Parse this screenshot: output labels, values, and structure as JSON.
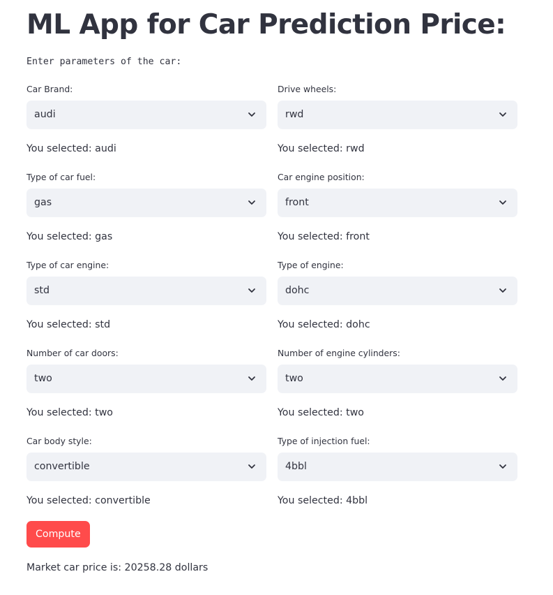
{
  "title": "ML App for Car Prediction Price:",
  "intro": "Enter parameters of the car:",
  "fields": [
    {
      "label": "Car Brand:",
      "value": "audi",
      "selected_text": "You selected: audi"
    },
    {
      "label": "Drive wheels:",
      "value": "rwd",
      "selected_text": "You selected: rwd"
    },
    {
      "label": "Type of car fuel:",
      "value": "gas",
      "selected_text": "You selected: gas"
    },
    {
      "label": "Car engine position:",
      "value": "front",
      "selected_text": "You selected: front"
    },
    {
      "label": "Type of car engine:",
      "value": "std",
      "selected_text": "You selected: std"
    },
    {
      "label": "Type of engine:",
      "value": "dohc",
      "selected_text": "You selected: dohc"
    },
    {
      "label": "Number of car doors:",
      "value": "two",
      "selected_text": "You selected: two"
    },
    {
      "label": "Number of engine cylinders:",
      "value": "two",
      "selected_text": "You selected: two"
    },
    {
      "label": "Car body style:",
      "value": "convertible",
      "selected_text": "You selected: convertible"
    },
    {
      "label": "Type of injection fuel:",
      "value": "4bbl",
      "selected_text": "You selected: 4bbl"
    }
  ],
  "compute_button": {
    "label": "Compute"
  },
  "result": "Market car price is: 20258.28 dollars",
  "colors": {
    "text": "#31333f",
    "select_bg": "#f0f2f6",
    "button_bg": "#ff4b4b",
    "button_text": "#ffffff"
  },
  "icons": {
    "select_chevron": "chevron-down-icon"
  }
}
